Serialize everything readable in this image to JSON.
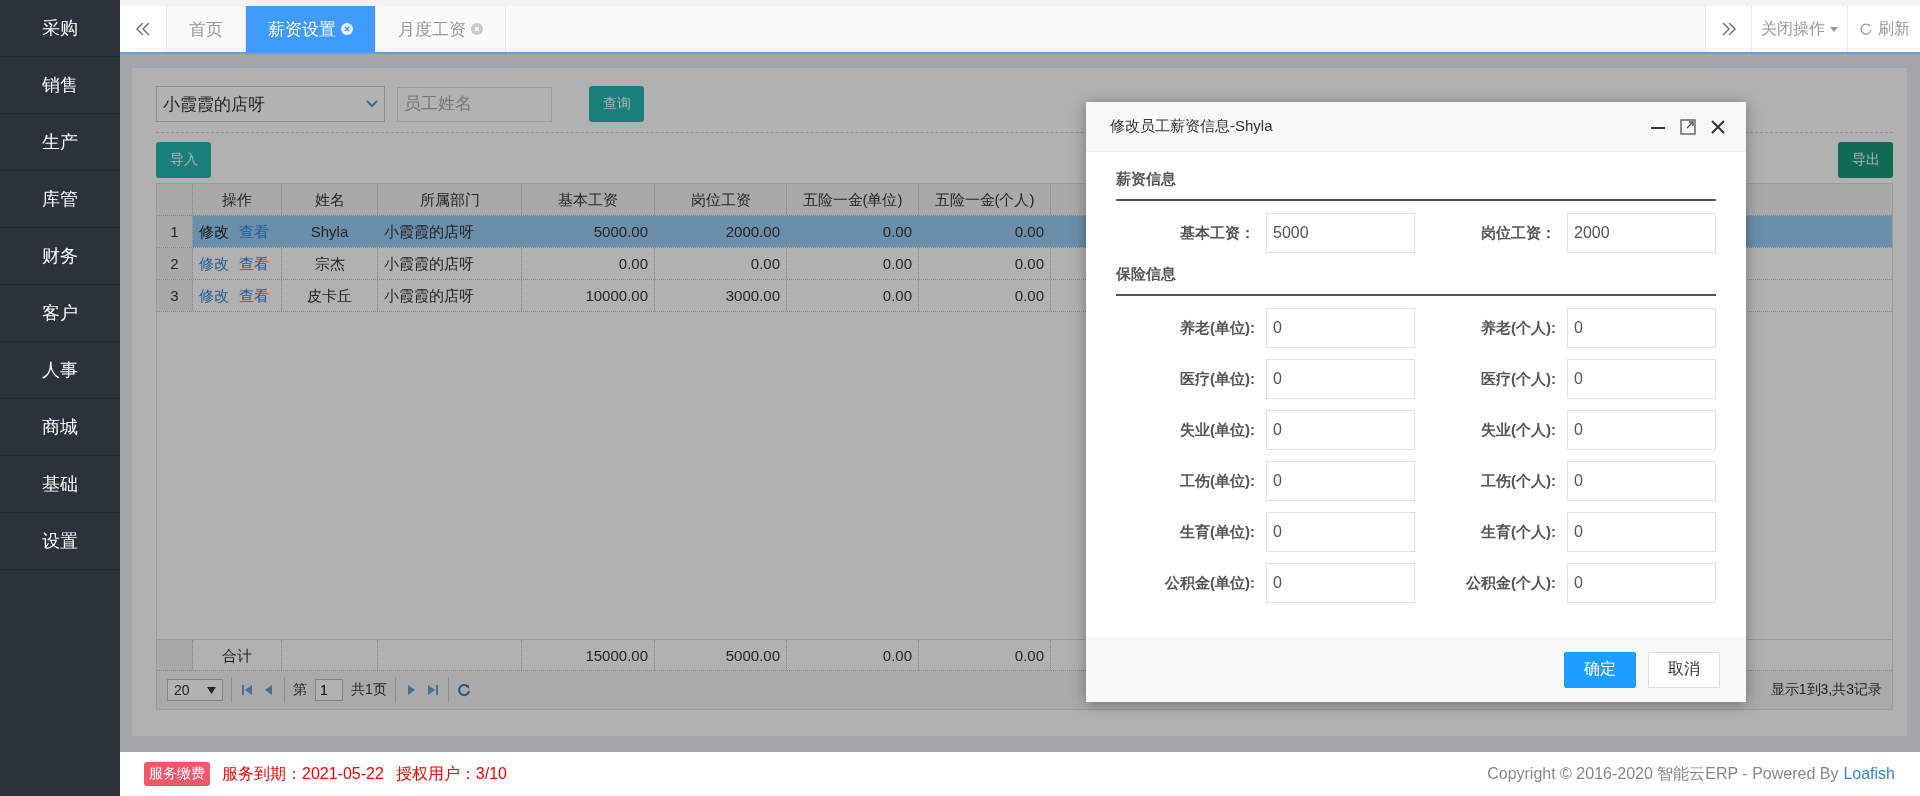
{
  "sidebar": {
    "items": [
      {
        "label": "采购"
      },
      {
        "label": "销售"
      },
      {
        "label": "生产"
      },
      {
        "label": "库管"
      },
      {
        "label": "财务"
      },
      {
        "label": "客户"
      },
      {
        "label": "人事"
      },
      {
        "label": "商城"
      },
      {
        "label": "基础"
      },
      {
        "label": "设置"
      }
    ]
  },
  "tabs": [
    {
      "label": "首页",
      "selected": false,
      "closable": false
    },
    {
      "label": "薪资设置",
      "selected": true,
      "closable": true
    },
    {
      "label": "月度工资",
      "selected": false,
      "closable": true
    }
  ],
  "tab_actions": {
    "close_menu": "关闭操作",
    "refresh": "刷新"
  },
  "toolbar": {
    "store_select": "小霞霞的店呀",
    "name_field": {
      "placeholder": "员工姓名"
    },
    "query_button": "查询",
    "import_button": "导入",
    "export_button": "导出"
  },
  "table": {
    "columns": [
      "操作",
      "姓名",
      "所属部门",
      "基本工资",
      "岗位工资",
      "五险一金(单位)",
      "五险一金(个人)"
    ],
    "rows": [
      {
        "index": "1",
        "selected": true,
        "cells": [
          [
            "修改",
            "查看"
          ],
          "Shyla",
          "小霞霞的店呀",
          "5000.00",
          "2000.00",
          "0.00",
          "0.00"
        ]
      },
      {
        "index": "2",
        "selected": false,
        "cells": [
          [
            "修改",
            "查看"
          ],
          "宗杰",
          "小霞霞的店呀",
          "0.00",
          "0.00",
          "0.00",
          "0.00"
        ]
      },
      {
        "index": "3",
        "selected": false,
        "cells": [
          [
            "修改",
            "查看"
          ],
          "皮卡丘",
          "小霞霞的店呀",
          "10000.00",
          "3000.00",
          "0.00",
          "0.00"
        ]
      }
    ],
    "summary": {
      "label": "合计",
      "values": [
        "15000.00",
        "5000.00",
        "0.00",
        "0.00"
      ]
    }
  },
  "pager": {
    "page_size": "20",
    "page_prefix": "第",
    "page": "1",
    "page_total": "共1页",
    "info": "显示1到3,共3记录"
  },
  "dialog": {
    "title": "修改员工薪资信息-Shyla",
    "sections": [
      {
        "heading": "薪资信息",
        "fields": [
          {
            "label": "基本工资：",
            "value": "5000"
          },
          {
            "label": "岗位工资：",
            "value": "2000"
          }
        ]
      },
      {
        "heading": "保险信息",
        "fields": [
          {
            "label": "养老(单位):",
            "value": "0"
          },
          {
            "label": "养老(个人):",
            "value": "0"
          },
          {
            "label": "医疗(单位):",
            "value": "0"
          },
          {
            "label": "医疗(个人):",
            "value": "0"
          },
          {
            "label": "失业(单位):",
            "value": "0"
          },
          {
            "label": "失业(个人):",
            "value": "0"
          },
          {
            "label": "工伤(单位):",
            "value": "0"
          },
          {
            "label": "工伤(个人):",
            "value": "0"
          },
          {
            "label": "生育(单位):",
            "value": "0"
          },
          {
            "label": "生育(个人):",
            "value": "0"
          },
          {
            "label": "公积金(单位):",
            "value": "0"
          },
          {
            "label": "公积金(个人):",
            "value": "0"
          }
        ]
      }
    ],
    "buttons": [
      {
        "label": "确定",
        "kind": "primary"
      },
      {
        "label": "取消",
        "kind": "default"
      }
    ]
  },
  "footer": {
    "badge": "服务缴费",
    "expiry": "服务到期：2021-05-22",
    "users": "授权用户：3/10",
    "copyright": "Copyright © 2016-2020 智能云ERP - Powered By",
    "link": "Loafish"
  }
}
